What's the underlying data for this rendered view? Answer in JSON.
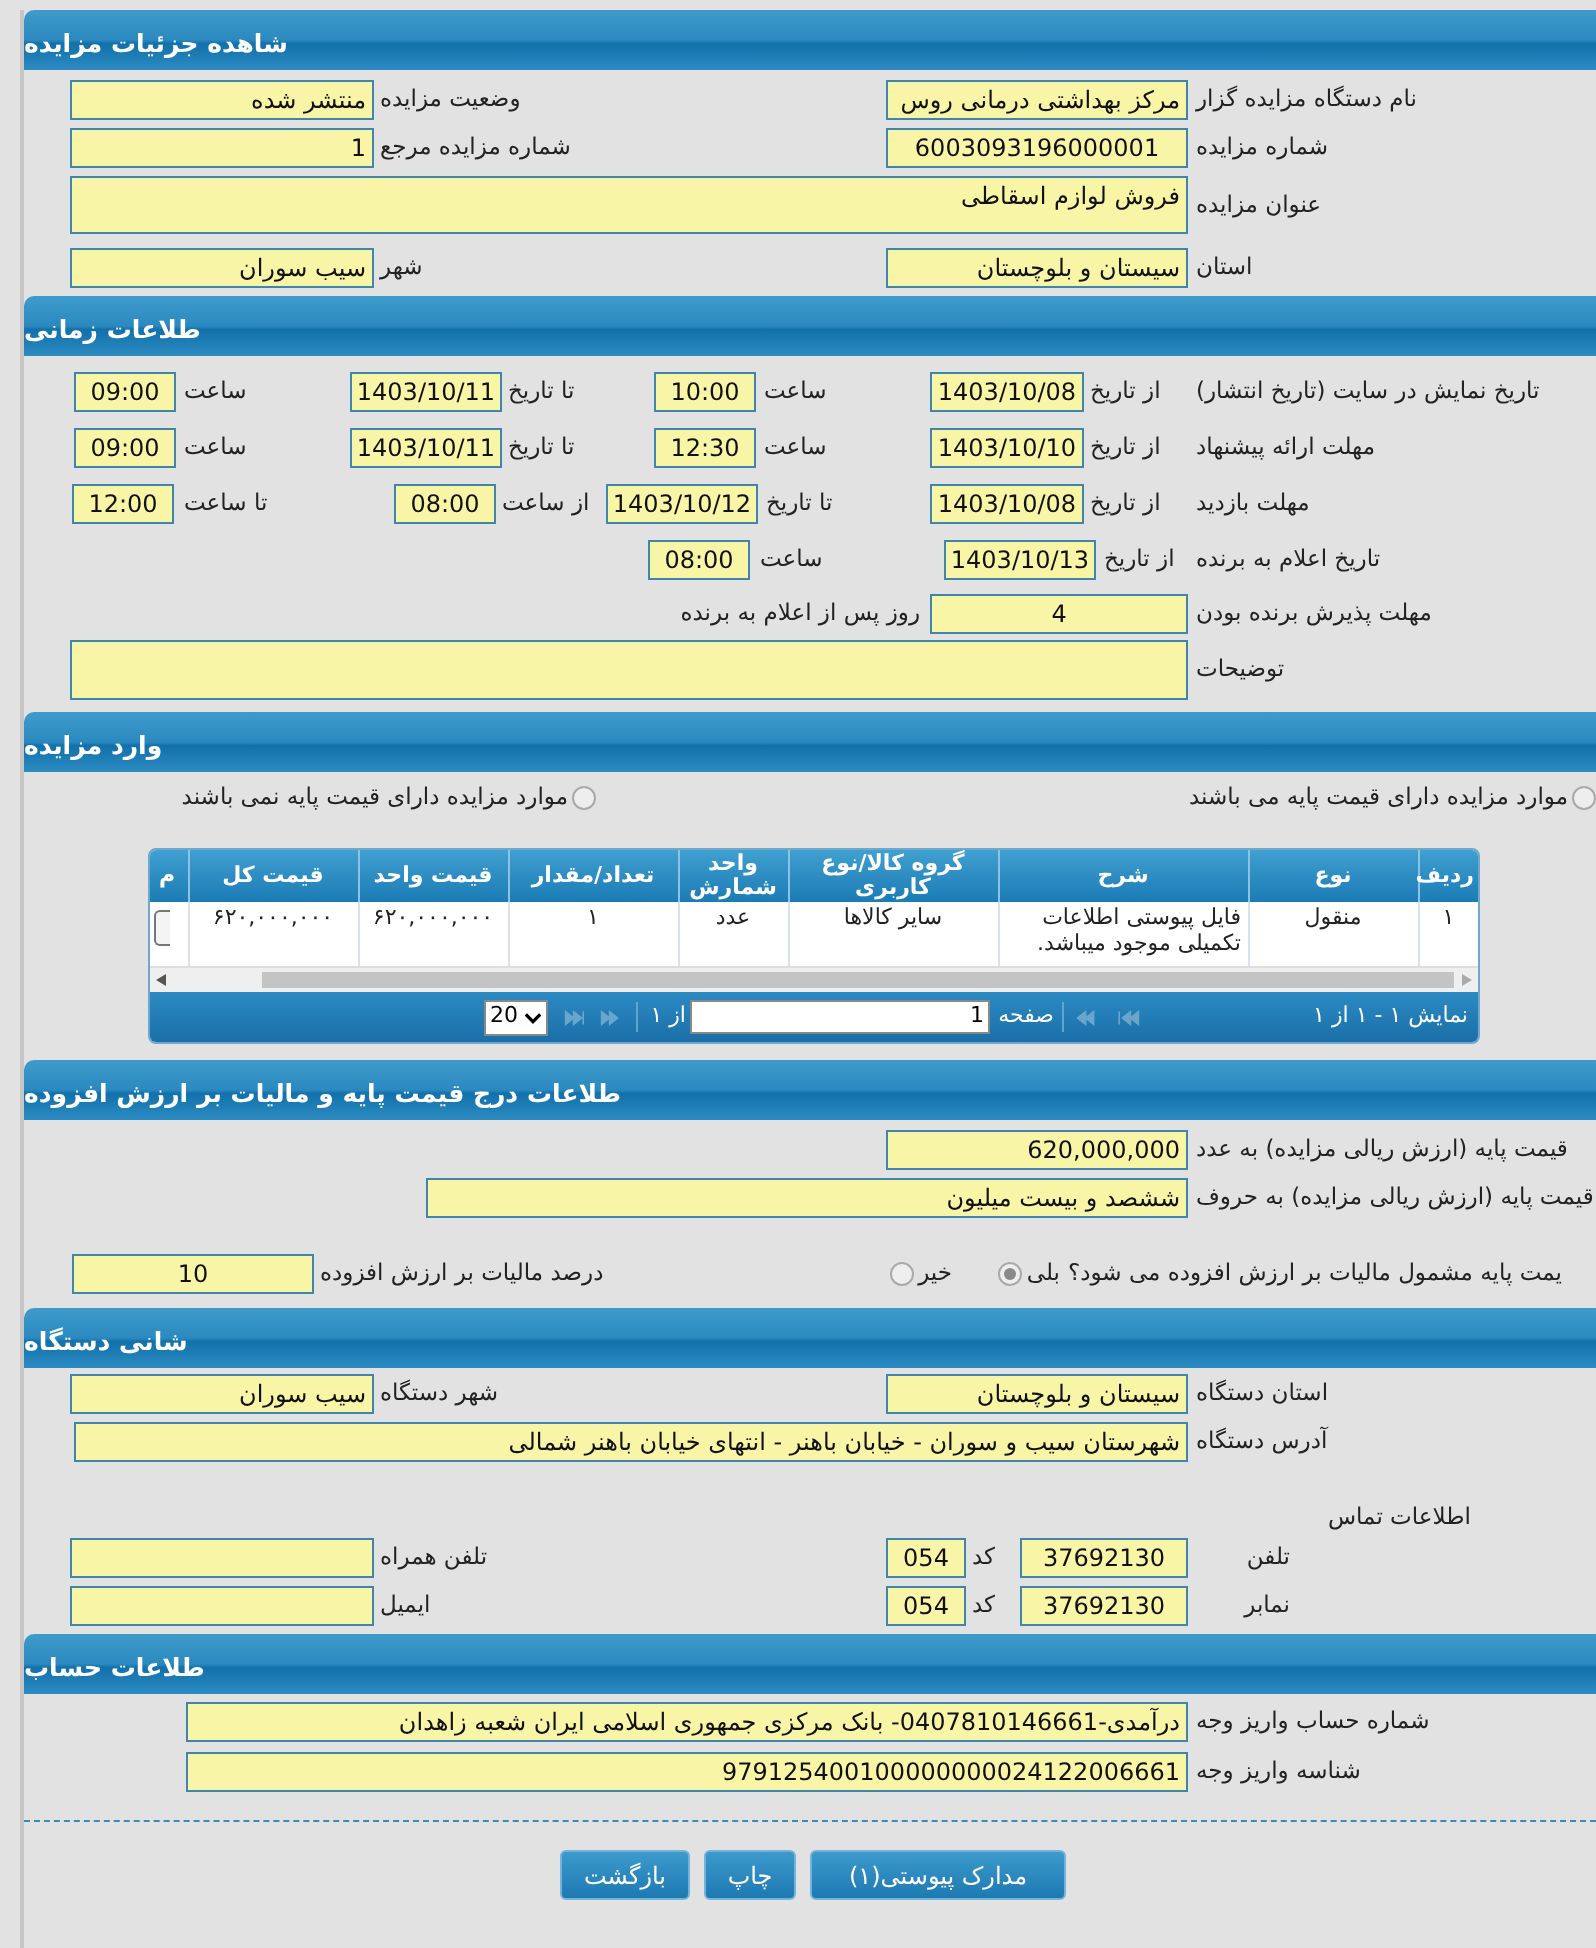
{
  "sections": [
    {
      "title": "شاهده جزئیات مزایده",
      "rows": [
        [
          {
            "kind": "label",
            "text": "نام دستگاه مزایده گزار"
          },
          {
            "kind": "field",
            "value": "مرکز بهداشتی درمانی روس"
          },
          {
            "kind": "label",
            "text": "وضعیت مزایده"
          },
          {
            "kind": "field",
            "value": "منتشر شده"
          }
        ],
        [
          {
            "kind": "label",
            "text": "شماره مزایده"
          },
          {
            "kind": "field",
            "value": "6003093196000001"
          },
          {
            "kind": "label",
            "text": "شماره مزایده مرجع"
          },
          {
            "kind": "field",
            "value": "1"
          }
        ],
        [
          {
            "kind": "label",
            "text": "عنوان مزایده"
          },
          {
            "kind": "area",
            "value": "فروش لوازم اسقاطی"
          }
        ],
        [
          {
            "kind": "label",
            "text": "استان"
          },
          {
            "kind": "field",
            "value": "سیستان و بلوچستان"
          },
          {
            "kind": "label",
            "text": "شهر"
          },
          {
            "kind": "field",
            "value": "سیب سوران"
          }
        ]
      ]
    },
    {
      "title": "طلاعات زمانی",
      "rows": [
        {
          "items": [
            {
              "kind": "label",
              "text": "تاریخ نمایش در سایت (تاریخ انتشار)"
            },
            {
              "kind": "label",
              "text": "از تاریخ"
            },
            {
              "kind": "field",
              "value": "1403/10/08"
            },
            {
              "kind": "label",
              "text": "ساعت"
            },
            {
              "kind": "field",
              "value": "10:00"
            },
            {
              "kind": "label",
              "text": "تا تاریخ"
            },
            {
              "kind": "field",
              "value": "1403/10/11"
            },
            {
              "kind": "label",
              "text": "ساعت"
            },
            {
              "kind": "field",
              "value": "09:00"
            }
          ]
        },
        {
          "items": [
            {
              "kind": "label",
              "text": "مهلت ارائه پیشنهاد"
            },
            {
              "kind": "label",
              "text": "از تاریخ"
            },
            {
              "kind": "field",
              "value": "1403/10/10"
            },
            {
              "kind": "label",
              "text": "ساعت"
            },
            {
              "kind": "field",
              "value": "12:30"
            },
            {
              "kind": "label",
              "text": "تا تاریخ"
            },
            {
              "kind": "field",
              "value": "1403/10/11"
            },
            {
              "kind": "label",
              "text": "ساعت"
            },
            {
              "kind": "field",
              "value": "09:00"
            }
          ]
        },
        {
          "items": [
            {
              "kind": "label",
              "text": "مهلت بازدید"
            },
            {
              "kind": "label",
              "text": "از تاریخ"
            },
            {
              "kind": "field",
              "value": "1403/10/08"
            },
            {
              "kind": "label",
              "text": "تا تاریخ"
            },
            {
              "kind": "field",
              "value": "1403/10/12"
            },
            {
              "kind": "label",
              "text": "از ساعت"
            },
            {
              "kind": "field",
              "value": "08:00"
            },
            {
              "kind": "label",
              "text": "تا ساعت"
            },
            {
              "kind": "field",
              "value": "12:00"
            }
          ]
        },
        {
          "items": [
            {
              "kind": "label",
              "text": "تاریخ اعلام به برنده"
            },
            {
              "kind": "label",
              "text": "از تاریخ"
            },
            {
              "kind": "field",
              "value": "1403/10/13"
            },
            {
              "kind": "label",
              "text": "ساعت"
            },
            {
              "kind": "field",
              "value": "08:00"
            }
          ]
        },
        {
          "items": [
            {
              "kind": "label",
              "text": "مهلت پذیرش برنده بودن"
            },
            {
              "kind": "field",
              "value": "4"
            },
            {
              "kind": "label",
              "text": "روز پس از اعلام به برنده"
            }
          ]
        },
        {
          "items": [
            {
              "kind": "label",
              "text": "توضیحات"
            },
            {
              "kind": "area"
            }
          ]
        }
      ]
    },
    {
      "title": "وارد مزایده",
      "rows": [
        [
          {
            "kind": "radio",
            "label": "موارد مزایده دارای قیمت پایه می باشند",
            "selected": false
          },
          {
            "kind": "radio",
            "label": "موارد مزایده دارای قیمت پایه نمی باشند",
            "selected": false
          }
        ]
      ],
      "table": {
        "columns": [
          "ردیف",
          "نوع",
          "شرح",
          "گروه کالا/نوع کاربری",
          "واحد شمارش",
          "تعداد/مقدار",
          "قیمت واحد",
          "قیمت کل",
          "م"
        ],
        "rows": [
          {
            "cells": [
              "۱",
              "منقول",
              "فایل پیوستی اطلاعات تکمیلی موجود میباشد.",
              "سایر کالاها",
              "عدد",
              "۱",
              "۶۲۰,۰۰۰,۰۰۰",
              "۶۲۰,۰۰۰,۰۰۰"
            ]
          }
        ],
        "pager": {
          "summary": "نمایش ۱ - ۱ از ۱",
          "page_label": "صفحه",
          "page": "1",
          "of": "از ۱",
          "page_size": "20",
          "nav": [
            {
              "kind": "first",
              "disabled": true
            },
            {
              "kind": "prev",
              "disabled": true
            },
            {
              "kind": "next",
              "disabled": true
            },
            {
              "kind": "last",
              "disabled": true
            }
          ]
        }
      }
    },
    {
      "title": "طلاعات درج قیمت پایه و مالیات بر ارزش افزوده",
      "rows": [
        [
          {
            "kind": "label",
            "text": "قیمت پایه (ارزش ریالی مزایده) به عدد"
          },
          {
            "kind": "field",
            "value": "620,000,000"
          }
        ],
        [
          {
            "kind": "label",
            "text": "قیمت پایه (ارزش ریالی مزایده) به حروف"
          },
          {
            "kind": "field",
            "value": "ششصد و بیست میلیون"
          }
        ],
        [
          {
            "kind": "label",
            "text": "یمت پایه مشمول مالیات بر ارزش افزوده می شود؟"
          },
          {
            "kind": "radio",
            "label": "بلی",
            "selected": true
          },
          {
            "kind": "radio",
            "label": "خیر",
            "selected": false
          },
          {
            "kind": "label",
            "text": "درصد مالیات بر ارزش افزوده"
          },
          {
            "kind": "field",
            "value": "10"
          }
        ]
      ]
    },
    {
      "title": "شانی دستگاه",
      "rows": [
        [
          {
            "kind": "label",
            "text": "استان دستگاه"
          },
          {
            "kind": "field",
            "value": "سیستان و بلوچستان"
          },
          "",
          "",
          {
            "kind": "label",
            "text": "شهر دستگاه"
          },
          {
            "kind": "field",
            "value": "سیب سوران"
          }
        ],
        [
          {
            "kind": "label",
            "text": "آدرس دستگاه"
          },
          {
            "kind": "field",
            "value": "شهرستان سیب و سوران - خیابان باهنر - انتهای خیابان باهنر شمالی"
          }
        ],
        [
          {
            "kind": "label",
            "text": "اطلاعات تماس"
          }
        ],
        [
          {
            "kind": "label",
            "text": "تلفن"
          },
          {
            "kind": "field",
            "value": "37692130"
          },
          {
            "kind": "label",
            "text": "کد"
          },
          {
            "kind": "field",
            "value": "054"
          },
          {
            "kind": "label",
            "text": "تلفن همراه"
          },
          {
            "kind": "field"
          }
        ],
        [
          {
            "kind": "label",
            "text": "نمابر"
          },
          {
            "kind": "field",
            "value": "37692130"
          },
          {
            "kind": "label",
            "text": "کد"
          },
          {
            "kind": "field",
            "value": "054"
          },
          {
            "kind": "label",
            "text": "ایمیل"
          },
          {
            "kind": "field"
          }
        ]
      ]
    },
    {
      "title": "طلاعات حساب",
      "rows": [
        [
          {
            "kind": "label",
            "text": "شماره حساب واریز وجه"
          },
          {
            "kind": "field",
            "value": "درآمدی-0407810146661- بانک مرکزی جمهوری اسلامی ایران شعبه زاهدان"
          }
        ],
        [
          {
            "kind": "label",
            "text": "شناسه واریز وجه"
          },
          {
            "kind": "field",
            "value": "979125400100000000024122006661"
          }
        ]
      ]
    }
  ],
  "buttons": [
    "مدارک پیوستی(۱)",
    "چاپ",
    "بازگشت"
  ]
}
